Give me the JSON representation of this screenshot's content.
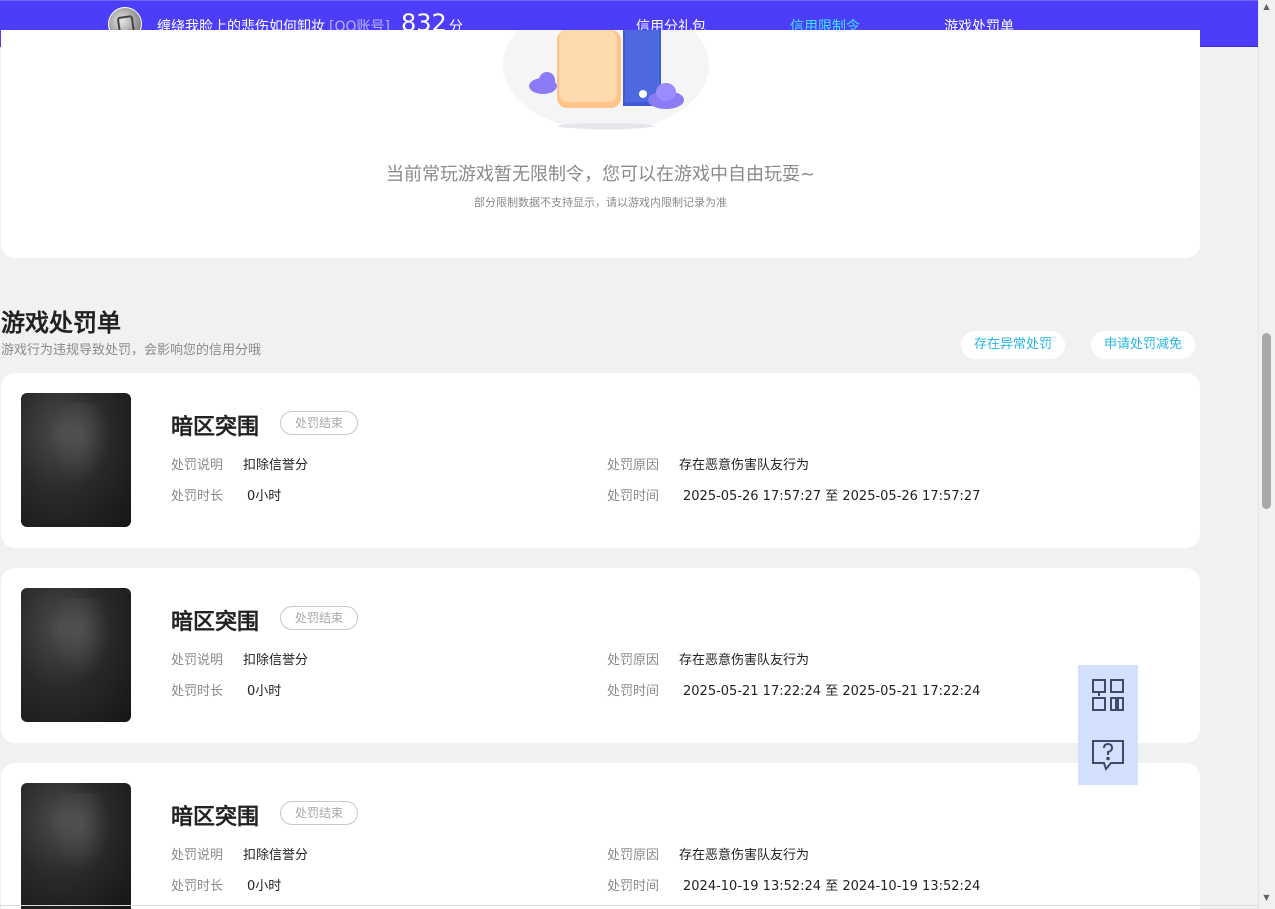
{
  "header": {
    "username": "缠绕我脸上的悲伤如何卸妆",
    "account_type": "[QQ账号]",
    "score": "832",
    "score_unit": "分",
    "nav": [
      {
        "label": "信用分礼包",
        "active": false
      },
      {
        "label": "信用限制令",
        "active": true
      },
      {
        "label": "游戏处罚单",
        "active": false
      }
    ]
  },
  "restriction": {
    "empty_title": "当前常玩游戏暂无限制令，您可以在游戏中自由玩耍~",
    "empty_note": "部分限制数据不支持显示，请以游戏内限制记录为准"
  },
  "penalty": {
    "title": "游戏处罚单",
    "subtitle": "游戏行为违规导致处罚，会影响您的信用分哦",
    "buttons": {
      "appeal": "存在异常处罚",
      "reduce": "申请处罚减免"
    },
    "labels": {
      "desc": "处罚说明",
      "duration": "处罚时长",
      "reason": "处罚原因",
      "time": "处罚时间",
      "to": "至"
    },
    "items": [
      {
        "game": "暗区突围",
        "status": "处罚结束",
        "desc": "扣除信誉分",
        "duration": "0小时",
        "reason": "存在恶意伤害队友行为",
        "start": "2025-05-26 17:57:27",
        "end": "2025-05-26 17:57:27"
      },
      {
        "game": "暗区突围",
        "status": "处罚结束",
        "desc": "扣除信誉分",
        "duration": "0小时",
        "reason": "存在恶意伤害队友行为",
        "start": "2025-05-21 17:22:24",
        "end": "2025-05-21 17:22:24"
      },
      {
        "game": "暗区突围",
        "status": "处罚结束",
        "desc": "扣除信誉分",
        "duration": "0小时",
        "reason": "存在恶意伤害队友行为",
        "start": "2024-10-19 13:52:24",
        "end": "2024-10-19 13:52:24"
      }
    ]
  },
  "side_tools": [
    {
      "icon": "qr-code-icon"
    },
    {
      "icon": "help-chat-icon"
    }
  ],
  "colors": {
    "header_bg": "#4c3dfb",
    "nav_active": "#3de7ff",
    "link_cyan": "#28b6e6",
    "float_bg": "#d3e0fb"
  }
}
